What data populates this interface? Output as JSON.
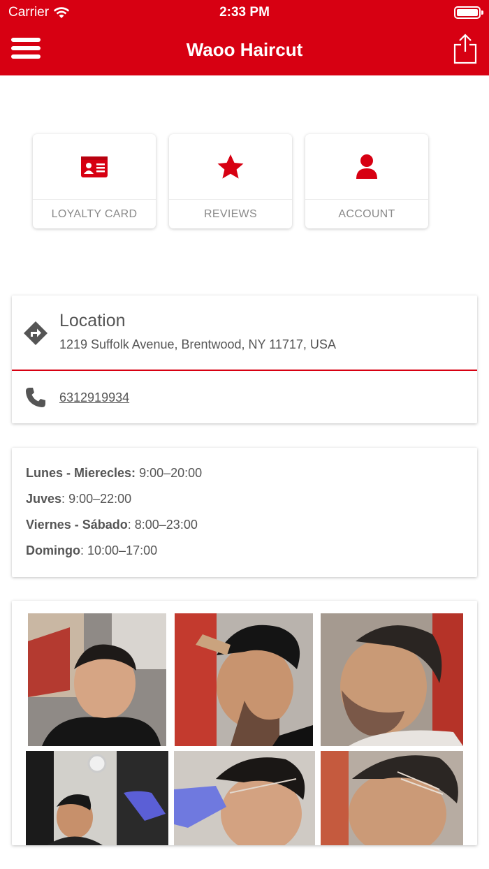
{
  "status_bar": {
    "carrier": "Carrier",
    "time": "2:33 PM"
  },
  "nav": {
    "title": "Waoo Haircut"
  },
  "shortcuts": [
    {
      "label": "LOYALTY CARD",
      "icon": "id-card-icon"
    },
    {
      "label": "REVIEWS",
      "icon": "star-icon"
    },
    {
      "label": "ACCOUNT",
      "icon": "user-icon"
    }
  ],
  "location": {
    "title": "Location",
    "address": "1219 Suffolk Avenue, Brentwood, NY 11717, USA",
    "phone": "6312919934"
  },
  "hours": [
    {
      "days": "Lunes - Mierecles:",
      "sep": " ",
      "time": "9:00–20:00"
    },
    {
      "days": "Juves",
      "sep": ": ",
      "time": "9:00–22:00"
    },
    {
      "days": "Viernes - Sábado",
      "sep": ": ",
      "time": "8:00–23:00"
    },
    {
      "days": "Domingo",
      "sep": ": ",
      "time": "10:00–17:00"
    }
  ],
  "colors": {
    "brand": "#d70012",
    "text": "#555555"
  }
}
